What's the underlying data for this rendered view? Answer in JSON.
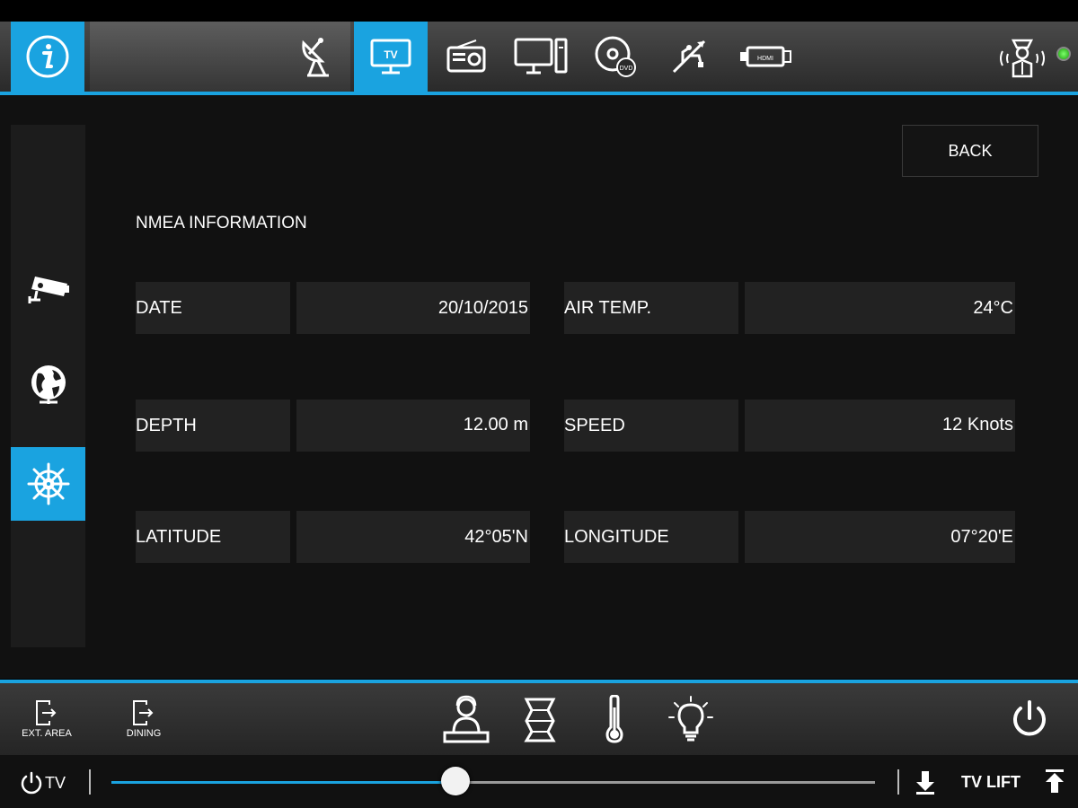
{
  "topbar": {
    "tabs": [
      {
        "name": "info-icon",
        "active": true
      },
      {
        "name": "satellite-icon",
        "active": false
      },
      {
        "name": "apple-tv-icon",
        "active": true,
        "badge": "TV"
      },
      {
        "name": "radio-icon",
        "active": false
      },
      {
        "name": "computer-icon",
        "active": false
      },
      {
        "name": "dvd-icon",
        "active": false,
        "badge": "DVD"
      },
      {
        "name": "usb-icon",
        "active": false
      },
      {
        "name": "hdmi-icon",
        "active": false,
        "badge": "HDMI"
      },
      {
        "name": "service-person-icon",
        "active": false
      }
    ]
  },
  "sidebar": {
    "items": [
      {
        "name": "camera-icon",
        "active": false
      },
      {
        "name": "globe-icon",
        "active": false
      },
      {
        "name": "ship-wheel-icon",
        "active": true
      }
    ]
  },
  "main": {
    "back_label": "BACK",
    "section_title": "NMEA INFORMATION",
    "fields": [
      {
        "label": "DATE",
        "value": "20/10/2015"
      },
      {
        "label": "AIR TEMP.",
        "value": "24°C"
      },
      {
        "label": "DEPTH",
        "value": "12.00 m"
      },
      {
        "label": "SPEED",
        "value": "12 Knots"
      },
      {
        "label": "LATITUDE",
        "value": "42°05'N"
      },
      {
        "label": "LONGITUDE",
        "value": "07°20'E"
      }
    ]
  },
  "bottombar": {
    "ext_area_label": "EXT. AREA",
    "dining_label": "DINING",
    "icons": [
      "reception-icon",
      "blinds-icon",
      "thermometer-icon",
      "lightbulb-icon",
      "power-icon"
    ]
  },
  "sliderbar": {
    "tv_label": "TV",
    "tv_lift_label": "TV LIFT",
    "slider_value": 0.45
  },
  "colors": {
    "accent": "#1aa3e0",
    "status_led": "#3ad12a"
  }
}
